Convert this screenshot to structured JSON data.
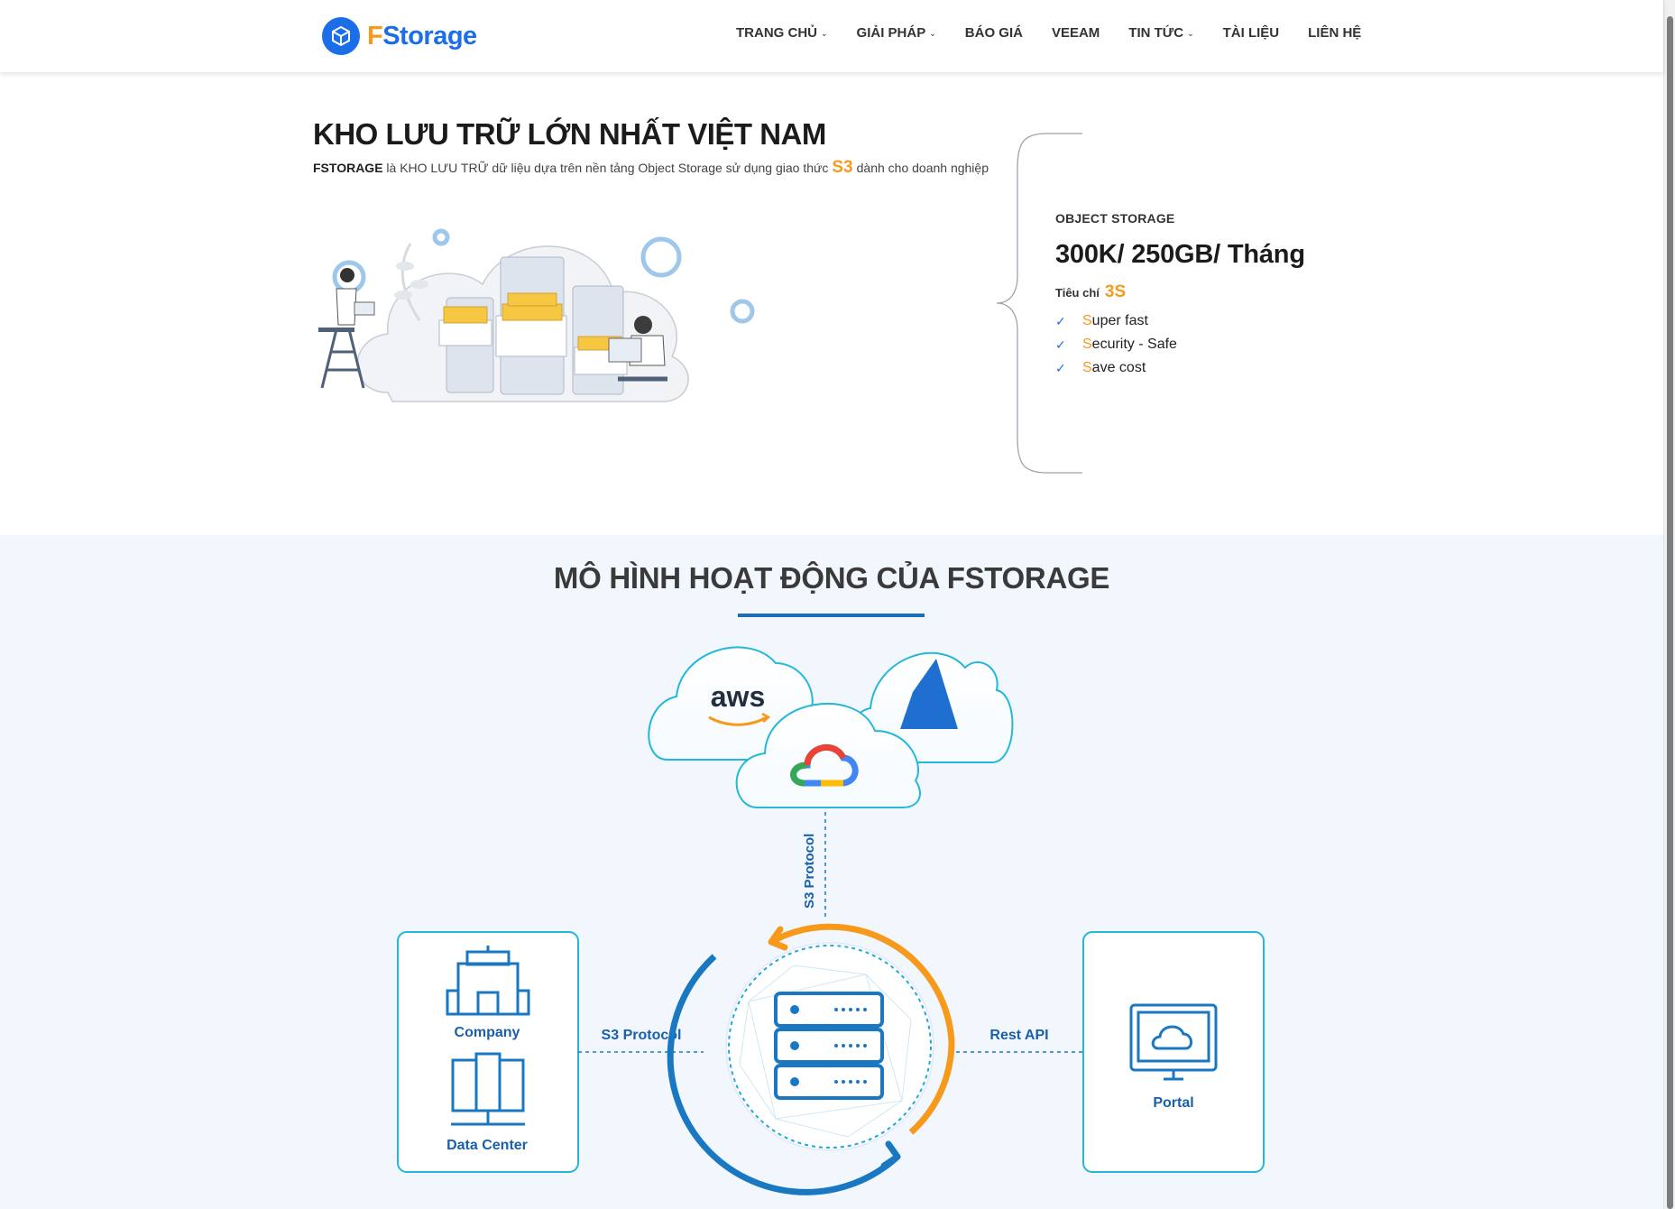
{
  "header": {
    "logo": {
      "letter": "F",
      "rest": "Storage"
    },
    "nav": [
      {
        "label": "TRANG CHỦ",
        "dropdown": true
      },
      {
        "label": "GIẢI PHÁP",
        "dropdown": true
      },
      {
        "label": "BÁO GIÁ",
        "dropdown": false
      },
      {
        "label": "VEEAM",
        "dropdown": false
      },
      {
        "label": "TIN TỨC",
        "dropdown": true
      },
      {
        "label": "TÀI LIỆU",
        "dropdown": false
      },
      {
        "label": "LIÊN HỆ",
        "dropdown": false
      }
    ]
  },
  "hero": {
    "title": "KHO LƯU TRỮ LỚN NHẤT VIỆT NAM",
    "desc_brand": "FSTORAGE",
    "desc_part1": " là KHO LƯU TRỮ dữ liệu dựa trên nền tảng Object Storage sử dụng giao thức",
    "desc_s3": "S3",
    "desc_part2": "dành cho doanh nghiệp"
  },
  "pricing": {
    "kicker": "OBJECT STORAGE",
    "price": "300K/ 250GB/ Tháng",
    "criteria_label": "Tiêu chí",
    "criteria_value": "3S",
    "features": [
      {
        "first": "S",
        "rest": "uper fast"
      },
      {
        "first": "S",
        "rest": "ecurity - Safe"
      },
      {
        "first": "S",
        "rest": "ave cost"
      }
    ]
  },
  "model": {
    "title": "MÔ HÌNH HOẠT ĐỘNG CỦA FSTORAGE",
    "aws": "aws",
    "vertical_protocol": "S3 Protocol",
    "left_protocol": "S3 Protocol",
    "right_protocol": "Rest API",
    "left_card": {
      "company": "Company",
      "datacenter": "Data Center"
    },
    "right_card": {
      "portal": "Portal"
    }
  },
  "colors": {
    "brand_blue": "#1c6ee8",
    "accent_orange": "#f79a1b",
    "diagram_blue": "#1a5fa8",
    "section_bg": "#f1f7fd"
  }
}
